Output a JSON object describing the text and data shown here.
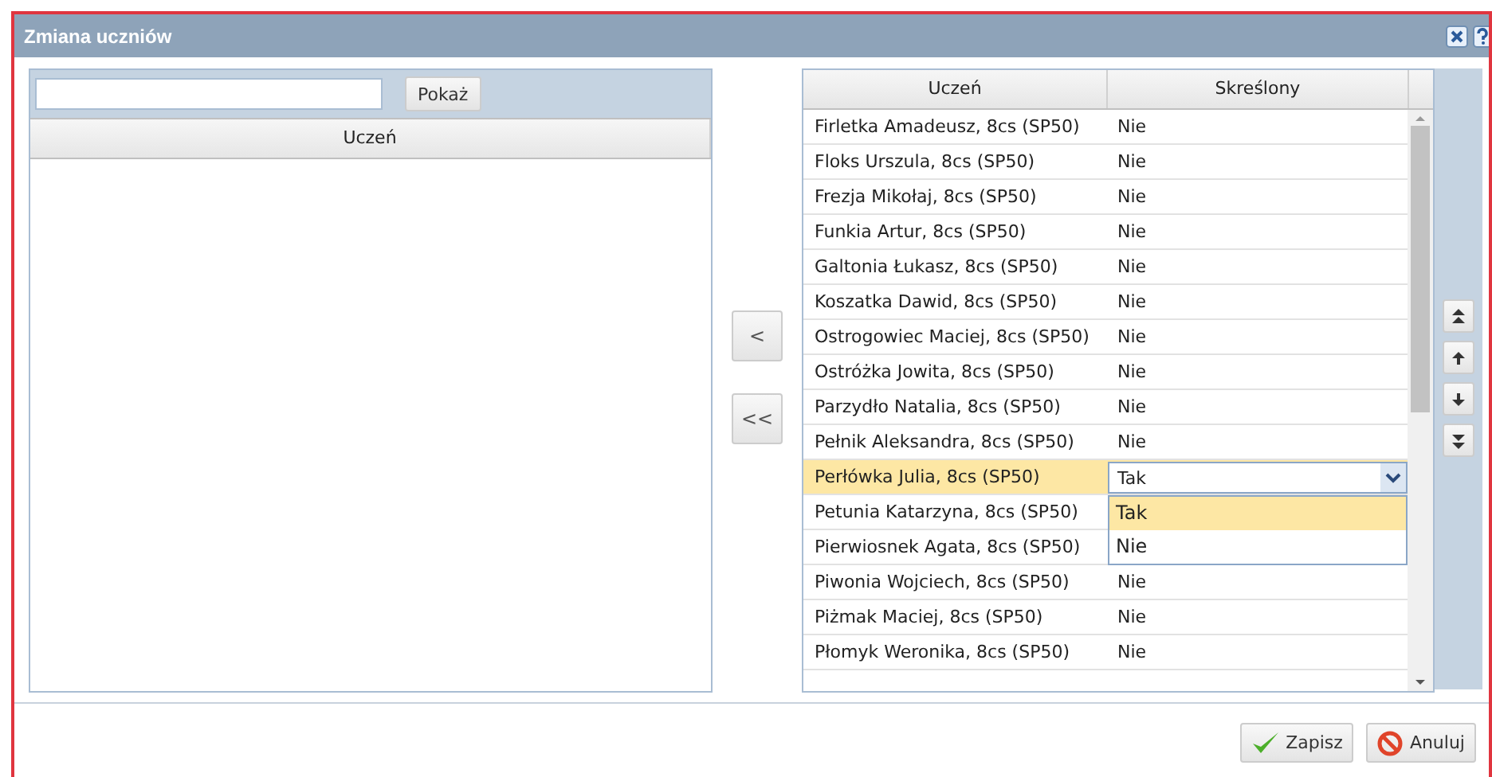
{
  "window": {
    "title": "Zmiana uczniów"
  },
  "left_panel": {
    "show_button": "Pokaż",
    "columns": [
      "Uczeń"
    ]
  },
  "transfer_buttons": [
    "<",
    "<<"
  ],
  "right_grid": {
    "columns": [
      "Uczeń",
      "Skreślony"
    ],
    "rows": [
      {
        "name": "Firletka Amadeusz, 8cs (SP50)",
        "value": "Nie",
        "selected": false
      },
      {
        "name": "Floks Urszula, 8cs (SP50)",
        "value": "Nie",
        "selected": false
      },
      {
        "name": "Frezja Mikołaj, 8cs (SP50)",
        "value": "Nie",
        "selected": false
      },
      {
        "name": "Funkia Artur, 8cs (SP50)",
        "value": "Nie",
        "selected": false
      },
      {
        "name": "Galtonia Łukasz, 8cs (SP50)",
        "value": "Nie",
        "selected": false
      },
      {
        "name": "Koszatka Dawid, 8cs (SP50)",
        "value": "Nie",
        "selected": false
      },
      {
        "name": "Ostrogowiec Maciej, 8cs (SP50)",
        "value": "Nie",
        "selected": false
      },
      {
        "name": "Ostróżka Jowita, 8cs (SP50)",
        "value": "Nie",
        "selected": false
      },
      {
        "name": "Parzydło Natalia, 8cs (SP50)",
        "value": "Nie",
        "selected": false
      },
      {
        "name": "Pełnik Aleksandra, 8cs (SP50)",
        "value": "Nie",
        "selected": false
      },
      {
        "name": "Perłówka Julia, 8cs (SP50)",
        "selected": true,
        "editor": {
          "value": "Tak",
          "options": [
            {
              "label": "Tak",
              "selected": true
            },
            {
              "label": "Nie",
              "selected": false
            }
          ]
        }
      },
      {
        "name": "Petunia Katarzyna, 8cs (SP50)",
        "selected": false
      },
      {
        "name": "Pierwiosnek Agata, 8cs (SP50)",
        "selected": false
      },
      {
        "name": "Piwonia Wojciech, 8cs (SP50)",
        "value": "Nie",
        "selected": false
      },
      {
        "name": "Piżmak Maciej, 8cs (SP50)",
        "value": "Nie",
        "selected": false
      },
      {
        "name": "Płomyk Weronika, 8cs (SP50)",
        "value": "Nie",
        "selected": false
      }
    ]
  },
  "footer_buttons": [
    {
      "kind": "save",
      "label": "Zapisz"
    },
    {
      "kind": "cancel",
      "label": "Anuluj"
    }
  ]
}
